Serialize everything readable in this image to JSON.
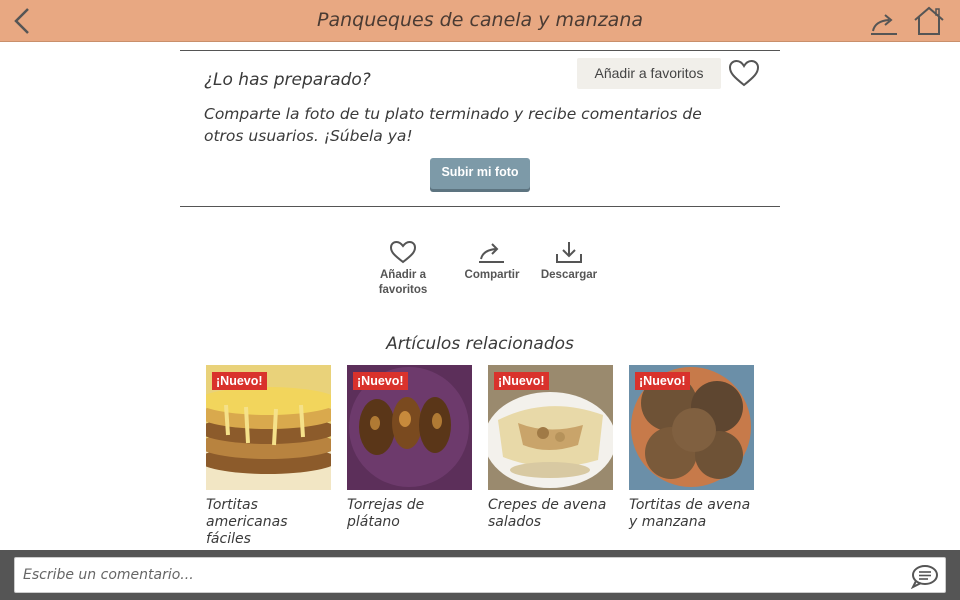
{
  "header": {
    "title": "Panqueques de canela y manzana",
    "back_icon": "chevron-left-icon",
    "share_icon": "share-icon",
    "home_icon": "home-icon",
    "bar_color": "#e8a882"
  },
  "prepared": {
    "title": "¿Lo has preparado?",
    "favorites_label": "Añadir a favoritos",
    "favorites_icon": "heart-icon",
    "text": "Comparte la foto de tu plato terminado y recibe comentarios de otros usuarios. ¡Súbela ya!",
    "upload_button": "Subir mi foto"
  },
  "actions": [
    {
      "label": "Añadir a favoritos",
      "icon": "heart-icon"
    },
    {
      "label": "Compartir",
      "icon": "share-icon"
    },
    {
      "label": "Descargar",
      "icon": "download-icon"
    }
  ],
  "related": {
    "title": "Artículos relacionados",
    "badge": "¡Nuevo!",
    "badge_color": "#d9322c",
    "items": [
      {
        "caption": "Tortitas americanas fáciles"
      },
      {
        "caption": "Torrejas de plátano"
      },
      {
        "caption": "Crepes de avena salados"
      },
      {
        "caption": "Tortitas de avena y manzana"
      }
    ]
  },
  "comment": {
    "placeholder": "Escribe un comentario...",
    "send_icon": "comment-send-icon"
  }
}
